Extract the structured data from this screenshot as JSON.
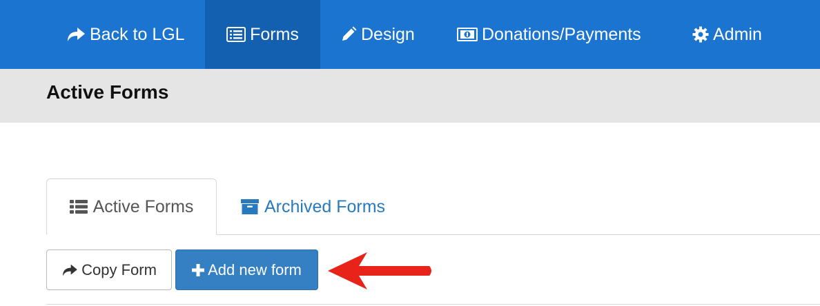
{
  "nav": {
    "back_label": "Back to LGL",
    "forms_label": "Forms",
    "design_label": "Design",
    "donations_label": "Donations/Payments",
    "admin_label": "Admin"
  },
  "header": {
    "title": "Active Forms"
  },
  "tabs": {
    "active_label": "Active Forms",
    "archived_label": "Archived Forms"
  },
  "toolbar": {
    "copy_label": "Copy Form",
    "add_label": "Add new form"
  },
  "colors": {
    "nav_bg": "#1b74cf",
    "nav_active_bg": "#135fb0",
    "primary_button": "#3580c2",
    "link_blue": "#2879bd",
    "annotation_arrow": "#e8231a"
  },
  "icons": {
    "back": "share-arrow-icon",
    "forms": "list-alt-icon",
    "design": "pencil-icon",
    "donations": "money-icon",
    "admin": "gear-icon",
    "active_tab": "th-list-icon",
    "archived_tab": "archive-box-icon",
    "copy": "share-arrow-icon",
    "add": "plus-icon"
  }
}
